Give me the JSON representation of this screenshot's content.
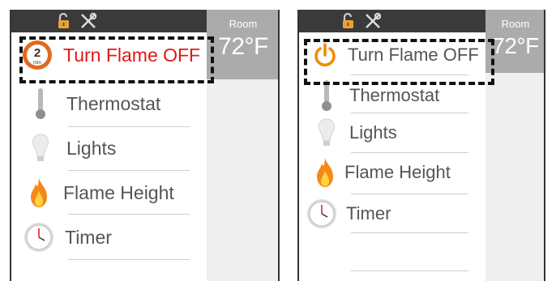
{
  "left_screen": {
    "room_label": "Room",
    "room_temp": "72°F",
    "menu": [
      {
        "label": "Turn Flame OFF",
        "icon": "timer-2-min-flame-off-icon",
        "badge_number": "2",
        "badge_unit": "min"
      },
      {
        "label": "Thermostat",
        "icon": "thermometer-icon"
      },
      {
        "label": "Lights",
        "icon": "light-bulb-icon"
      },
      {
        "label": "Flame Height",
        "icon": "flame-icon"
      },
      {
        "label": "Timer",
        "icon": "clock-icon"
      }
    ]
  },
  "right_screen": {
    "room_label": "Room",
    "room_temp": "72°F",
    "menu": [
      {
        "label": "Turn Flame OFF",
        "icon": "power-icon"
      },
      {
        "label": "Thermostat",
        "icon": "thermometer-icon"
      },
      {
        "label": "Lights",
        "icon": "light-bulb-icon"
      },
      {
        "label": "Flame Height",
        "icon": "flame-icon"
      },
      {
        "label": "Timer",
        "icon": "clock-icon"
      }
    ]
  },
  "colors": {
    "active_text": "#e01818",
    "power_orange": "#f08a00",
    "topbar": "#3a3a3a",
    "room_box": "#ababab"
  }
}
